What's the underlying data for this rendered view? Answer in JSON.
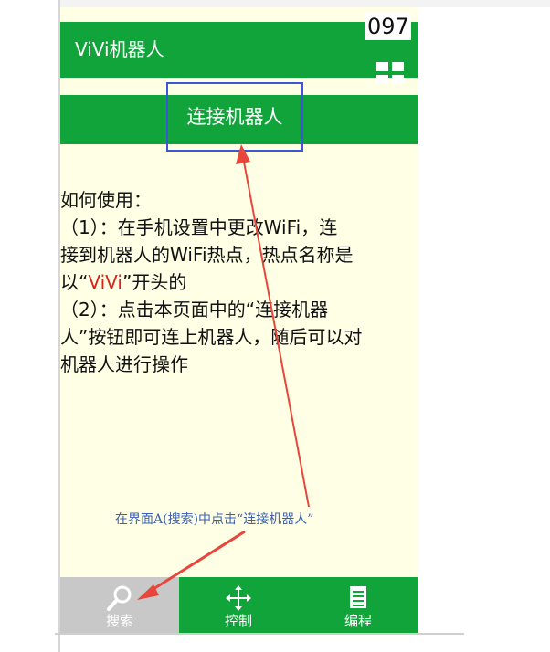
{
  "app": {
    "title": "ViVi机器人",
    "counter": "097"
  },
  "connect": {
    "label": "连接机器人"
  },
  "instructions": {
    "lines": [
      "如何使用：",
      "（1）：在手机设置中更改WiFi，连",
      "接到机器人的WiFi热点，热点名称是",
      {
        "prefix": "以“",
        "highlight": "ViVi",
        "suffix": "”开头的"
      },
      "（2）：点击本页面中的“连接机器",
      "人”按钮即可连上机器人，随后可以对",
      "机器人进行操作"
    ]
  },
  "annotation": {
    "caption": "在界面A(搜索)中点击“连接机器人”"
  },
  "tabs": [
    {
      "label": "搜索",
      "icon": "search-icon",
      "active": true
    },
    {
      "label": "控制",
      "icon": "move-arrows-icon",
      "active": false
    },
    {
      "label": "编程",
      "icon": "document-list-icon",
      "active": false
    }
  ],
  "colors": {
    "green": "#11a43a",
    "background": "#ffffe6",
    "highlight": "#d6251b",
    "annotation_arrow": "#e8463c",
    "annotation_box": "#3c58d8"
  }
}
